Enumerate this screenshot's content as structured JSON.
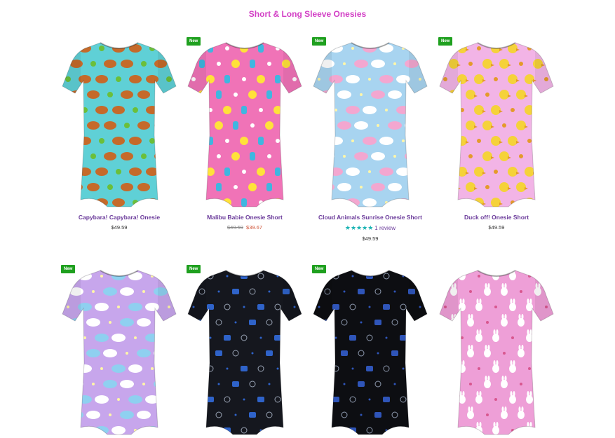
{
  "page": {
    "title": "Short & Long Sleeve Onesies"
  },
  "products": [
    {
      "name": "Capybara! Capybara! Onesie",
      "price": "$49.59",
      "badge": "",
      "pattern": "capybara",
      "colors": {
        "bg": "#5fd0d6",
        "a": "#c56a2a",
        "b": "#6bbf3a"
      }
    },
    {
      "name": "Malibu Babie Onesie Short",
      "old_price": "$49.59",
      "sale_price": "$39.67",
      "badge": "New",
      "pattern": "malibu",
      "colors": {
        "bg": "#f073b7",
        "a": "#ffe23a",
        "b": "#3fb6e0"
      }
    },
    {
      "name": "Cloud Animals Sunrise Onesie Short",
      "price": "$49.59",
      "badge": "New",
      "rating_stars": "★★★★★",
      "review_text": "1 review",
      "pattern": "clouds",
      "colors": {
        "bg": "#a8d4f0",
        "a": "#f3a7d0",
        "b": "#ffffff"
      }
    },
    {
      "name": "Duck off! Onesie Short",
      "price": "$49.59",
      "badge": "New",
      "pattern": "duck",
      "colors": {
        "bg": "#f2b4e6",
        "a": "#f5d23a",
        "b": "#e49a2a"
      }
    },
    {
      "name": "",
      "badge": "New",
      "pattern": "clouds2",
      "colors": {
        "bg": "#c7a6ec",
        "a": "#8fd0f0",
        "b": "#ffffff"
      }
    },
    {
      "name": "",
      "badge": "New",
      "pattern": "dark",
      "colors": {
        "bg": "#15171e",
        "a": "#2f63c9",
        "b": "#9aa4b5"
      }
    },
    {
      "name": "",
      "badge": "New",
      "pattern": "dark",
      "colors": {
        "bg": "#0d0e12",
        "a": "#2f55b9",
        "b": "#8f9bb0"
      }
    },
    {
      "name": "",
      "badge": "",
      "pattern": "bunny",
      "colors": {
        "bg": "#ee9fd7",
        "a": "#ffffff",
        "b": "#d8578f"
      }
    }
  ]
}
